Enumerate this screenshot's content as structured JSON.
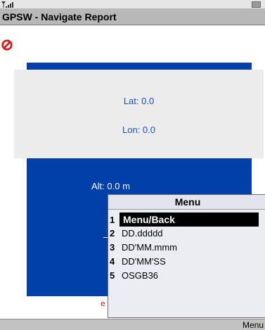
{
  "window": {
    "title": "GPSW - Navigate Report"
  },
  "report": {
    "lat": "Lat: 0.0",
    "lon": "Lon: 0.0",
    "alt": "Alt: 0.0 m"
  },
  "menu": {
    "title": "Menu",
    "items": [
      {
        "num": "1",
        "label": "Menu/Back",
        "selected": true
      },
      {
        "num": "2",
        "label": "DD.ddddd"
      },
      {
        "num": "3",
        "label": "DD'MM.mmm"
      },
      {
        "num": "4",
        "label": "DD'MM'SS"
      },
      {
        "num": "5",
        "label": "OSGB36"
      }
    ]
  },
  "softkeys": {
    "right": "Menu"
  },
  "colors": {
    "panel_blue": "#0040a8",
    "title_bar": "#b8b8b8",
    "coord_text": "#1a4fc0"
  },
  "icons": {
    "status": [
      "signal-icon",
      "battery-icon"
    ],
    "header": "stop-icon"
  }
}
